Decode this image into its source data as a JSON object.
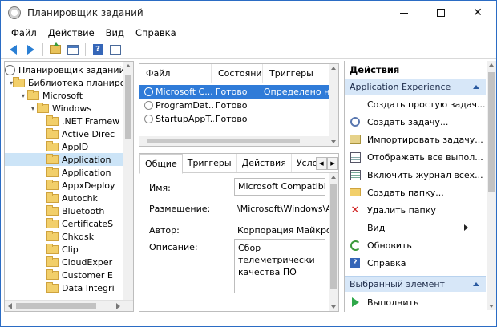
{
  "window": {
    "title": "Планировщик заданий"
  },
  "menu": [
    "Файл",
    "Действие",
    "Вид",
    "Справка"
  ],
  "toolbar": {
    "icons": [
      "back-arrow-icon",
      "forward-arrow-icon",
      "folder-up-icon",
      "show-hide-console-tree-icon",
      "help-icon",
      "show-action-pane-icon"
    ]
  },
  "tree": {
    "root": "Планировщик заданий (...",
    "library": "Библиотека планиро...",
    "microsoft": "Microsoft",
    "windows": "Windows",
    "children": [
      ".NET Framew",
      "Active Direc",
      "AppID",
      "Application",
      "Application",
      "AppxDeploy",
      "Autochk",
      "Bluetooth",
      "CertificateS",
      "Chkdsk",
      "Clip",
      "CloudExper",
      "Customer E",
      "Data Integri"
    ],
    "selected_index": 3
  },
  "task_list": {
    "columns": [
      "Файл",
      "Состояние",
      "Триггеры"
    ],
    "rows": [
      {
        "name": "Microsoft C...",
        "state": "Готово",
        "trigger": "Определено неск..."
      },
      {
        "name": "ProgramDat...",
        "state": "Готово",
        "trigger": ""
      },
      {
        "name": "StartupAppT...",
        "state": "Готово",
        "trigger": ""
      }
    ],
    "selected_index": 0
  },
  "details": {
    "tabs": [
      "Общие",
      "Триггеры",
      "Действия",
      "Условия"
    ],
    "active_tab": 0,
    "fields": {
      "name_label": "Имя:",
      "name_value": "Microsoft Compatibilit",
      "location_label": "Размещение:",
      "location_value": "\\Microsoft\\Windows\\A",
      "author_label": "Автор:",
      "author_value": "Корпорация Майкрос",
      "description_label": "Описание:",
      "description_line1": "Сбор телеметрически",
      "description_line2": "качества ПО"
    }
  },
  "actions": {
    "title": "Действия",
    "section1": "Application Experience",
    "items": [
      {
        "label": "Создать простую задач...",
        "icon": "create-basic-task-icon"
      },
      {
        "label": "Создать задачу...",
        "icon": "create-task-icon"
      },
      {
        "label": "Импортировать задачу...",
        "icon": "import-task-icon"
      },
      {
        "label": "Отображать все выпол...",
        "icon": "display-running-tasks-icon"
      },
      {
        "label": "Включить журнал всех...",
        "icon": "enable-history-icon"
      },
      {
        "label": "Создать папку...",
        "icon": "new-folder-icon"
      },
      {
        "label": "Удалить папку",
        "icon": "delete-icon"
      },
      {
        "label": "Вид",
        "icon": ""
      },
      {
        "label": "Обновить",
        "icon": "refresh-icon"
      },
      {
        "label": "Справка",
        "icon": "help-icon"
      }
    ],
    "section2": "Выбранный элемент",
    "selected_items": [
      {
        "label": "Выполнить",
        "icon": "run-icon"
      }
    ]
  },
  "colors": {
    "selection": "#2f7bd8",
    "tree_selection": "#cce4f7",
    "section_header": "#d7e7f8",
    "window_border": "#2b6cc4"
  }
}
